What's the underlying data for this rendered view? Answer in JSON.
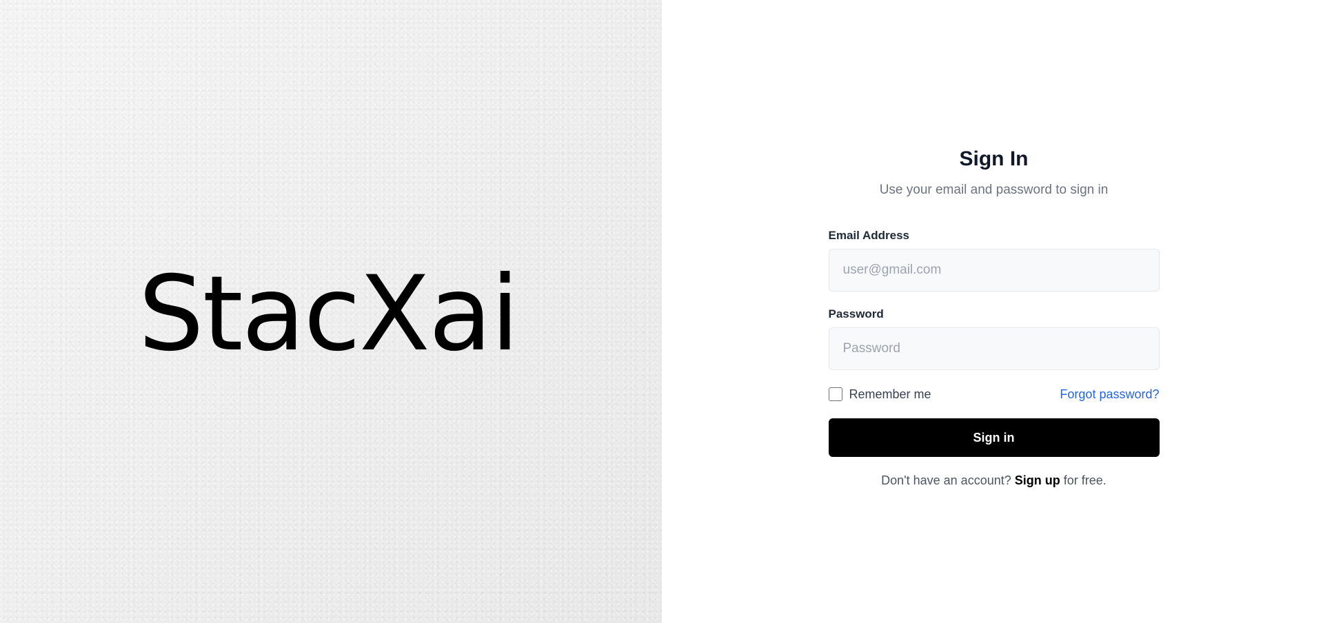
{
  "brand": {
    "logo_text": "StacXai"
  },
  "auth": {
    "title": "Sign In",
    "subtitle": "Use your email and password to sign in",
    "email": {
      "label": "Email Address",
      "placeholder": "user@gmail.com",
      "value": ""
    },
    "password": {
      "label": "Password",
      "placeholder": "Password",
      "value": ""
    },
    "remember_me": {
      "label": "Remember me",
      "checked": false
    },
    "forgot_password_label": "Forgot password?",
    "submit_label": "Sign in",
    "signup": {
      "prefix": "Don't have an account?",
      "link_label": "Sign up",
      "suffix": "for free."
    }
  },
  "colors": {
    "accent_link": "#2563eb",
    "button_bg": "#000000",
    "title_text": "#111827",
    "muted_text": "#6b7280",
    "input_bg": "#f8f9fb"
  }
}
